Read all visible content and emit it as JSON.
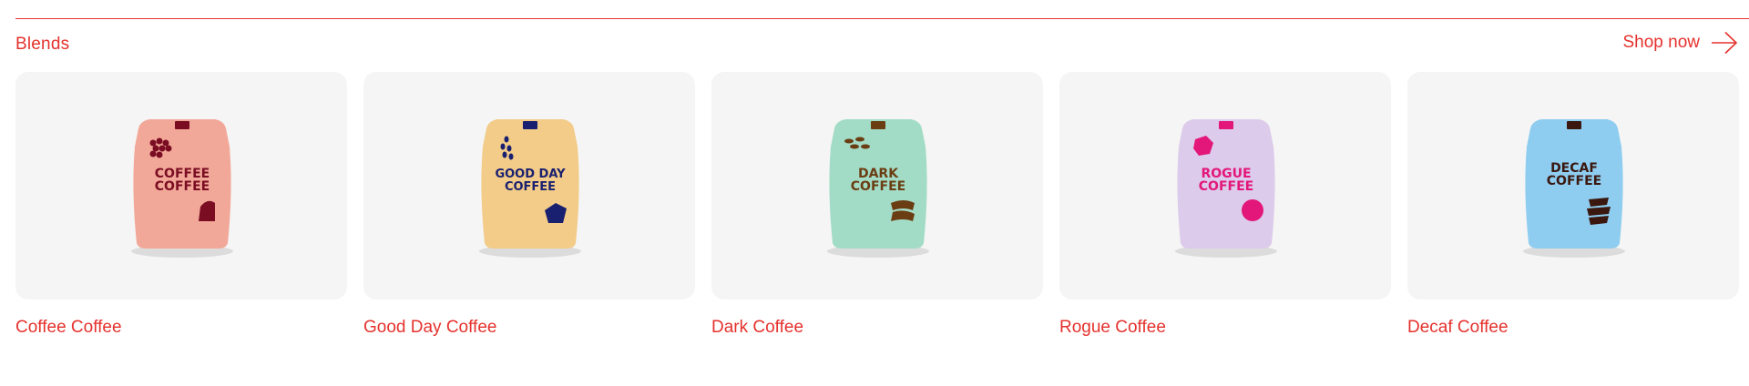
{
  "section": {
    "title": "Blends",
    "shop_label": "Shop now",
    "shop_icon": "arrow-right-icon",
    "accent": "#e5322d"
  },
  "products": [
    {
      "name": "Coffee Coffee",
      "bag_line1": "COFFEE",
      "bag_line2": "COFFEE",
      "bag_color": "#f2a899",
      "ink_color": "#7a0d22"
    },
    {
      "name": "Good Day Coffee",
      "bag_line1": "GOOD DAY",
      "bag_line2": "COFFEE",
      "bag_color": "#f2cc88",
      "ink_color": "#1a2070"
    },
    {
      "name": "Dark Coffee",
      "bag_line1": "DARK",
      "bag_line2": "COFFEE",
      "bag_color": "#a3dcc6",
      "ink_color": "#6b3d12"
    },
    {
      "name": "Rogue Coffee",
      "bag_line1": "ROGUE",
      "bag_line2": "COFFEE",
      "bag_color": "#dccbea",
      "ink_color": "#e3177a"
    },
    {
      "name": "Decaf Coffee",
      "bag_line1": "DECAF",
      "bag_line2": "COFFEE",
      "bag_color": "#8fcdf0",
      "ink_color": "#3a1810"
    }
  ]
}
